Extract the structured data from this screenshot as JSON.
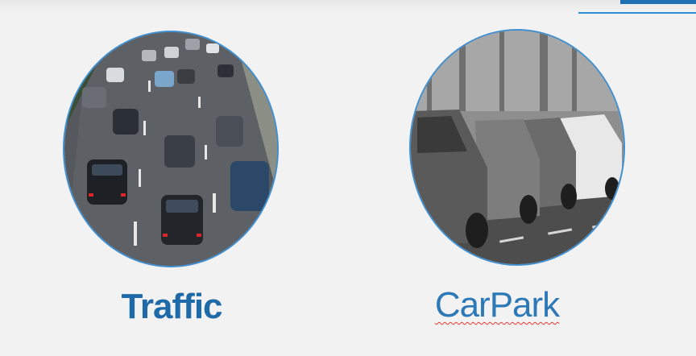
{
  "header": {
    "accent_color": "#2b8fd6"
  },
  "cards": [
    {
      "id": "traffic",
      "label": "Traffic",
      "image": "highway-traffic-photo"
    },
    {
      "id": "carpark",
      "label": "CarPark",
      "image": "parked-cars-photo",
      "spellcheck_flag": true
    }
  ],
  "colors": {
    "label": "#1e6aa8",
    "circle_border": "#3f8fd0",
    "spellcheck": "#e53935"
  }
}
